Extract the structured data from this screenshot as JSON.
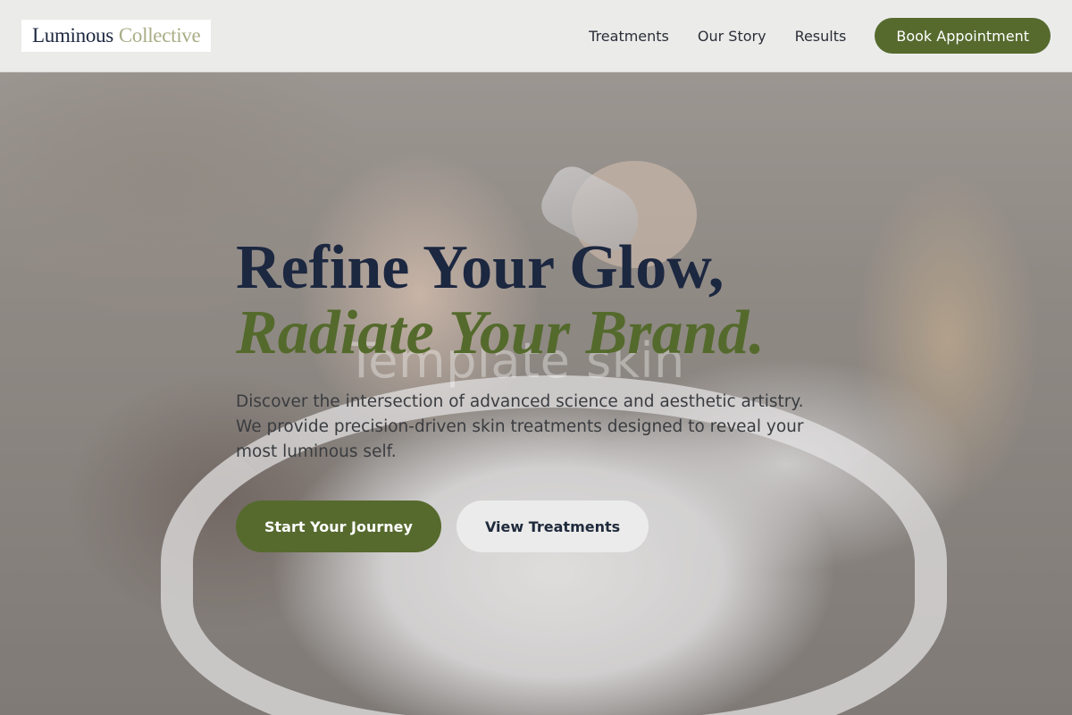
{
  "header": {
    "logo": {
      "primary": "Luminous",
      "accent": "Collective"
    },
    "nav": [
      {
        "label": "Treatments"
      },
      {
        "label": "Our Story"
      },
      {
        "label": "Results"
      }
    ],
    "book_button": "Book Appointment"
  },
  "hero": {
    "headline_line1": "Refine Your Glow,",
    "headline_line2": "Radiate Your Brand.",
    "watermark": "Template skin",
    "description": "Discover the intersection of advanced science and aesthetic artistry. We provide precision-driven skin treatments designed to reveal your most luminous self.",
    "primary_button": "Start Your Journey",
    "secondary_button": "View Treatments"
  },
  "colors": {
    "brand_green": "#566a2e",
    "navy_text": "#1c2740",
    "logo_accent": "#a9ad86"
  }
}
